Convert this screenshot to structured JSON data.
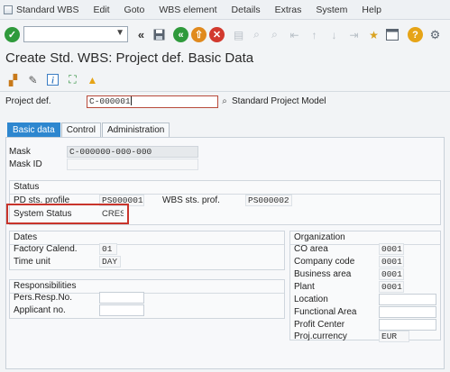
{
  "menu": {
    "items": [
      "Standard WBS",
      "Edit",
      "Goto",
      "WBS element",
      "Details",
      "Extras",
      "System",
      "Help"
    ]
  },
  "toolbar": {
    "icons": [
      "enter-check-icon",
      "back-icon",
      "save-icon",
      "back-arrow-icon",
      "exit-icon",
      "cancel-icon",
      "print-icon",
      "find-icon",
      "find-next-icon",
      "first-page-icon",
      "previous-page-icon",
      "next-page-icon",
      "last-page-icon",
      "create-session-icon",
      "layout-icon",
      "help-icon",
      "settings-icon"
    ]
  },
  "page": {
    "title": "Create Std. WBS: Project def. Basic Data"
  },
  "header": {
    "project_label": "Project def.",
    "project_value": "C-000001",
    "project_desc": "Standard Project Model"
  },
  "tabs": [
    {
      "label": "Basic data",
      "active": true
    },
    {
      "label": "Control",
      "active": false
    },
    {
      "label": "Administration",
      "active": false
    }
  ],
  "mask": {
    "mask_label": "Mask",
    "mask_value": "C-000000-000-000",
    "maskid_label": "Mask ID",
    "maskid_value": ""
  },
  "status": {
    "title": "Status",
    "pd_label": "PD sts. profile",
    "pd_value": "PS000001",
    "wbs_label": "WBS sts. prof.",
    "wbs_value": "PS000002",
    "system_label": "System Status",
    "system_value": "CRES"
  },
  "dates": {
    "title": "Dates",
    "factory_label": "Factory Calend.",
    "factory_value": "01",
    "timeunit_label": "Time unit",
    "timeunit_value": "DAY"
  },
  "responsibilities": {
    "title": "Responsibilities",
    "pers_label": "Pers.Resp.No.",
    "pers_value": "",
    "applicant_label": "Applicant no.",
    "applicant_value": ""
  },
  "organization": {
    "title": "Organization",
    "co_label": "CO area",
    "co_value": "0001",
    "company_label": "Company code",
    "company_value": "0001",
    "business_label": "Business area",
    "business_value": "0001",
    "plant_label": "Plant",
    "plant_value": "0001",
    "location_label": "Location",
    "location_value": "",
    "functional_label": "Functional Area",
    "functional_value": "",
    "profit_label": "Profit Center",
    "profit_value": "",
    "currency_label": "Proj.currency",
    "currency_value": "EUR"
  },
  "colors": {
    "accent": "#2e87cf",
    "highlight": "#c8342b"
  }
}
